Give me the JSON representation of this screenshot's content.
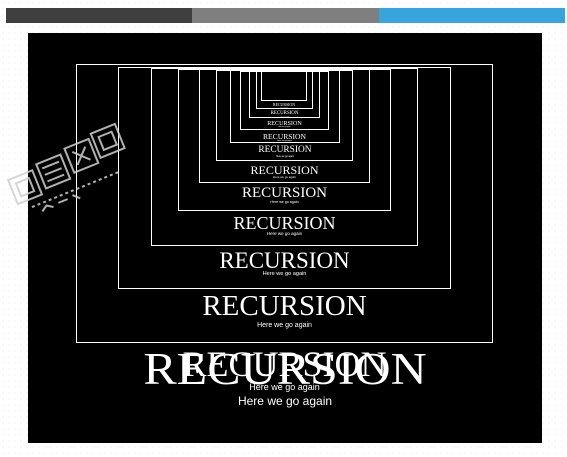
{
  "top_bar": {
    "segments": [
      {
        "color": "#3f3f3f"
      },
      {
        "color": "#7f7f7f"
      },
      {
        "color": "#35a5dc"
      }
    ]
  },
  "poster": {
    "title": "RECURSION",
    "caption": "Here we go again",
    "background": "#000000",
    "text_color": "#ffffff",
    "nested_copies": [
      {
        "title": "RECURSION",
        "caption": "Here we go again"
      },
      {
        "title": "RECURSION",
        "caption": "Here we go again"
      },
      {
        "title": "RECURSION",
        "caption": "Here we go again"
      },
      {
        "title": "RECURSION",
        "caption": "Here we go again"
      },
      {
        "title": "RECURSION",
        "caption": "Here we go again"
      },
      {
        "title": "RECURSION",
        "caption": "Here we go again"
      },
      {
        "title": "RECURSION",
        "caption": "Here we go again"
      },
      {
        "title": "RECURSION",
        "caption": "Here we go again"
      },
      {
        "title": "RECURSION",
        "caption": "Here we go again"
      },
      {
        "title": "RECURSION",
        "caption": "Here we go again"
      },
      {
        "title": "RECURSION",
        "caption": "Here we go again"
      }
    ]
  },
  "watermark": {
    "icon": "stamp-watermark-icon",
    "color": "#cfcfcf"
  }
}
